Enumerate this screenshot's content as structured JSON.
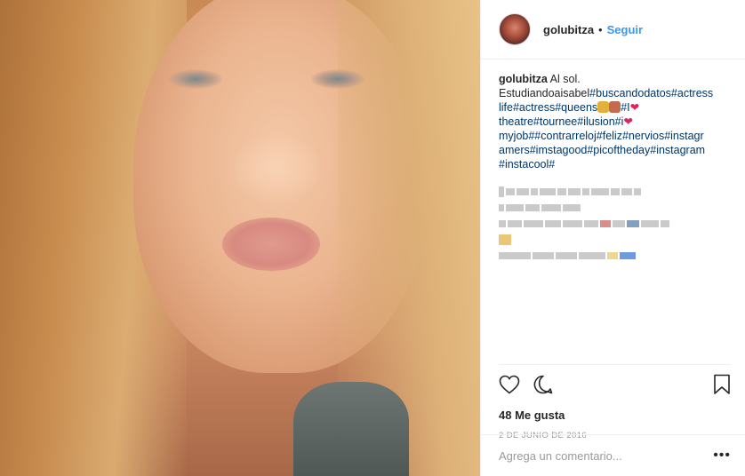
{
  "post": {
    "username": "golubitza",
    "separator": "•",
    "follow_label": "Seguir",
    "caption": {
      "username": "golubitza",
      "text": "Al sol.",
      "line1_plain": "Estudiandoaisabel",
      "line1_tags": "#buscandodatos#actress",
      "line2_tags": "life#actress#queens",
      "line2_tail": "#I",
      "line3_tags": "theatre#tournee#ilusion#i",
      "line4_tags": "myjob##contrarreloj#feliz#nervios#instagr",
      "line5_tags": "amers#imstagood#picoftheday#instagram",
      "line6_tags": "#instacool#"
    },
    "likes": "48 Me gusta",
    "date": "2 DE JUNIO DE 2016",
    "comment_placeholder": "Agrega un comentario...",
    "more_label": "•••"
  },
  "colors": {
    "link": "#3897f0",
    "hashtag": "#003569",
    "heart": "#e0245e"
  },
  "icons": [
    "like-heart-icon",
    "comment-bubble-icon",
    "bookmark-icon",
    "more-options-icon"
  ]
}
